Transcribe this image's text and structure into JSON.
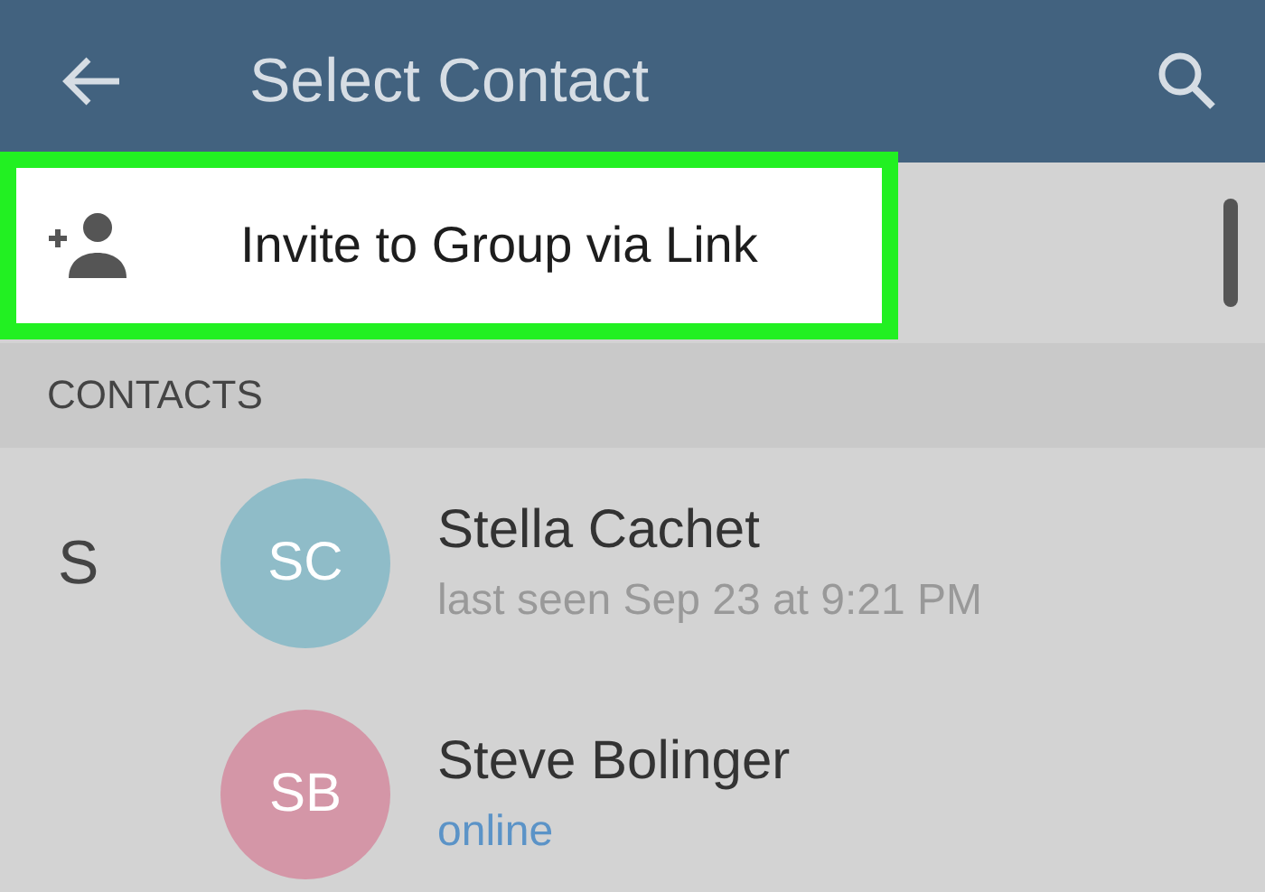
{
  "header": {
    "title": "Select Contact"
  },
  "invite": {
    "label": "Invite to Group via Link",
    "highlighted": true
  },
  "section": {
    "title": "CONTACTS"
  },
  "contacts": [
    {
      "letter": "S",
      "initials": "SC",
      "color": "#8fbcc8",
      "name": "Stella Cachet",
      "status": "last seen Sep 23 at 9:21 PM",
      "online": false
    },
    {
      "initials": "SB",
      "color": "#d496a7",
      "name": "Steve Bolinger",
      "status": "online",
      "online": true
    }
  ]
}
